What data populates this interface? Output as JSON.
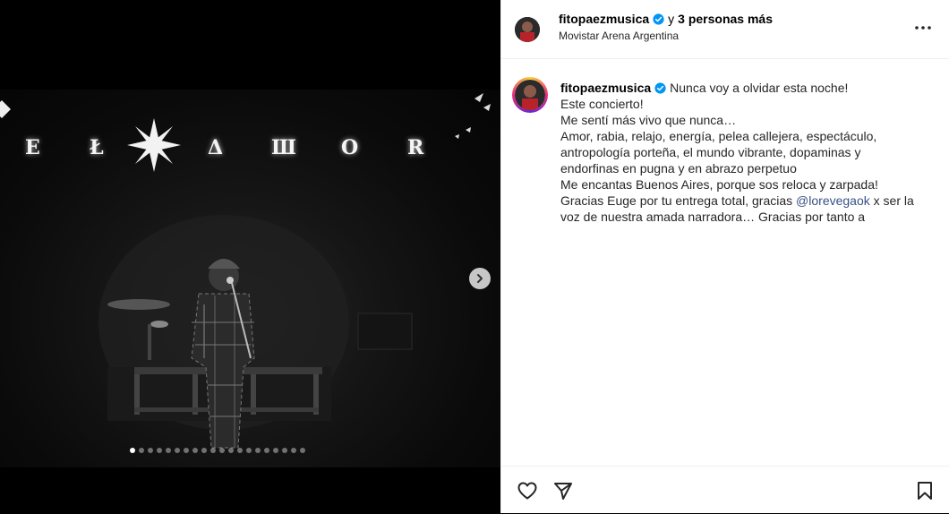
{
  "media": {
    "sign_letters": [
      "E",
      "Ł",
      "Δ",
      "Ш",
      "O",
      "R"
    ],
    "next_icon": "chevron-right-icon",
    "carousel": {
      "total_slides": 20,
      "active_index": 0
    }
  },
  "header": {
    "username": "fitopaezmusica",
    "collab_text": "y",
    "collab_count": "3 personas más",
    "location": "Movistar Arena Argentina",
    "more_icon": "more-horizontal-icon",
    "verified_color": "#0095f6"
  },
  "caption": {
    "username": "fitopaezmusica",
    "lines": [
      "Nunca voy a olvidar esta noche!",
      "Este concierto!",
      "Me sentí más vivo que nunca…",
      "Amor, rabia, relajo, energía, pelea callejera, espectáculo,",
      "antropología porteña, el mundo vibrante, dopaminas y",
      "endorfinas en pugna y en abrazo perpetuo",
      "Me encantas Buenos Aires, porque sos reloca y zarpada!",
      "Gracias Euge por tu entrega total, gracias",
      "x ser la",
      "voz de nuestra amada narradora… Gracias por tanto a"
    ],
    "mention": "@lorevegaok"
  },
  "actions": {
    "like_icon": "heart-icon",
    "share_icon": "send-icon",
    "save_icon": "bookmark-icon"
  }
}
